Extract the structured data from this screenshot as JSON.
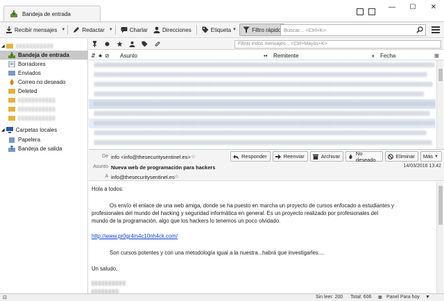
{
  "tab": {
    "title": "Bandeja de entrada"
  },
  "window_controls": {
    "minimize": "—",
    "maximize": "☐",
    "close": "✕"
  },
  "toolbar": {
    "get_messages": "Recibir mensajes",
    "write": "Redactar",
    "chat": "Charlar",
    "address_book": "Direcciones",
    "tag": "Etiqueta",
    "quick_filter": "Filtro rápido",
    "search_placeholder": "Buscar... <Ctrl+K>"
  },
  "folders": {
    "account_items": [
      {
        "label": "Bandeja de entrada",
        "icon": "inbox-icon",
        "selected": true
      },
      {
        "label": "Borradores",
        "icon": "drafts-icon"
      },
      {
        "label": "Enviados",
        "icon": "sent-icon"
      },
      {
        "label": "Correo no deseado",
        "icon": "junk-icon"
      },
      {
        "label": "Deleted",
        "icon": "folder-icon"
      }
    ],
    "local_folders": {
      "label": "Carpetas locales",
      "items": [
        {
          "label": "Papelera",
          "icon": "trash-icon"
        },
        {
          "label": "Bandeja de salida",
          "icon": "outbox-icon"
        }
      ]
    }
  },
  "filter": {
    "placeholder": "Filtrar estos mensajes... <Ctrl+Mayús+K>"
  },
  "columns": {
    "subject": "Asunto",
    "sender": "Remitente",
    "date": "Fecha"
  },
  "message": {
    "from_label": "De",
    "from": "info <info@thesecuritysentinel.es>",
    "subject_label": "Asunto",
    "subject": "Nueva web de programación para hackers",
    "to_label": "A",
    "to": "info@thesecuritysentinel.es",
    "date": "14/03/2016 13:42",
    "actions": {
      "reply": "Responder",
      "forward": "Reenviar",
      "archive": "Archivar",
      "junk": "No deseado",
      "delete": "Eliminar",
      "more": "Más"
    },
    "body": {
      "greeting": "Hola a todos:",
      "para1_line1": "Os envío el enlace de una web amiga, donde se ha puesto en marcha un proyecto de cursos enfocado a estudiantes y",
      "para1_line2": "profesionales del mundo  del hacking y seguridad informática en general. Es un proyecto realizado por profesionales del",
      "para1_line3": "mundo de la programación, algo que los hackers lo tenemos un poco olvidado.",
      "link": "http://www.pr0gr4m4c10nh4ck.com/",
      "para2": "Son cursos potentes y con una metodología igual a la nuestra...habrá que investigarles....",
      "closing": "Un saludo,"
    }
  },
  "status": {
    "unread": "Sin leer: 200",
    "total": "Total: 606",
    "today_pane": "Panel Para hoy"
  },
  "colors": {
    "selection": "#c8c8c8",
    "link": "#0b3fd6",
    "row_highlight": "#d6e4f5"
  }
}
